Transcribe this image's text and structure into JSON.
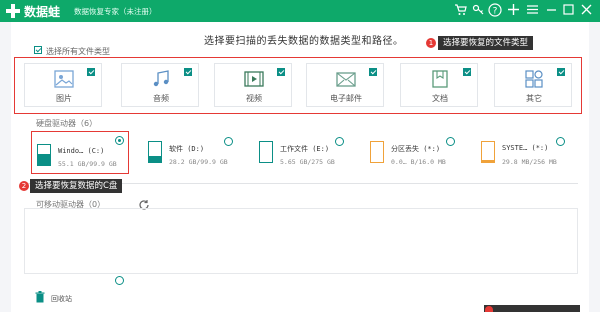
{
  "app": {
    "name": "数据蛙",
    "subtitle": "数据恢复专家（未注册）"
  },
  "instruction": "选择要扫描的丢失数据的数据类型和路径。",
  "callouts": {
    "file_types": {
      "number": "1",
      "text": "选择要恢复的文件类型"
    },
    "drive_c": {
      "number": "2",
      "text": "选择要恢复数据的C盘"
    }
  },
  "file_types": {
    "select_all_label": "选择所有文件类型",
    "items": [
      {
        "label": "图片",
        "icon": "image-icon"
      },
      {
        "label": "音频",
        "icon": "music-icon"
      },
      {
        "label": "视频",
        "icon": "video-icon"
      },
      {
        "label": "电子邮件",
        "icon": "mail-icon"
      },
      {
        "label": "文档",
        "icon": "document-icon"
      },
      {
        "label": "其它",
        "icon": "other-icon"
      }
    ]
  },
  "disks": {
    "label": "硬盘驱动器（6）",
    "items": [
      {
        "name": "Windo… (C:)",
        "size": "55.1 GB/99.9 GB",
        "fill": 0.55,
        "color": "#0b8f86",
        "selected": true
      },
      {
        "name": "软件 (D:)",
        "size": "28.2 GB/99.9 GB",
        "fill": 0.28,
        "color": "#0b8f86",
        "selected": false
      },
      {
        "name": "工作文件 (E:)",
        "size": "5.65 GB/275 GB",
        "fill": 0.02,
        "color": "#0b8f86",
        "selected": false
      },
      {
        "name": "分区丢失 (*:)",
        "size": "0.0… B/16.0 MB",
        "fill": 0.0,
        "color": "#f0a23a",
        "selected": false
      },
      {
        "name": "SYSTE… (*:)",
        "size": "29.8 MB/256 MB",
        "fill": 0.12,
        "color": "#f0a23a",
        "selected": false
      }
    ]
  },
  "removable": {
    "label": "可移动驱动器（0）"
  },
  "recycle_bin": {
    "label": "回收站"
  },
  "accent_color": "#0ea96a",
  "teal_color": "#0b8f86",
  "callout_color": "#e53935"
}
